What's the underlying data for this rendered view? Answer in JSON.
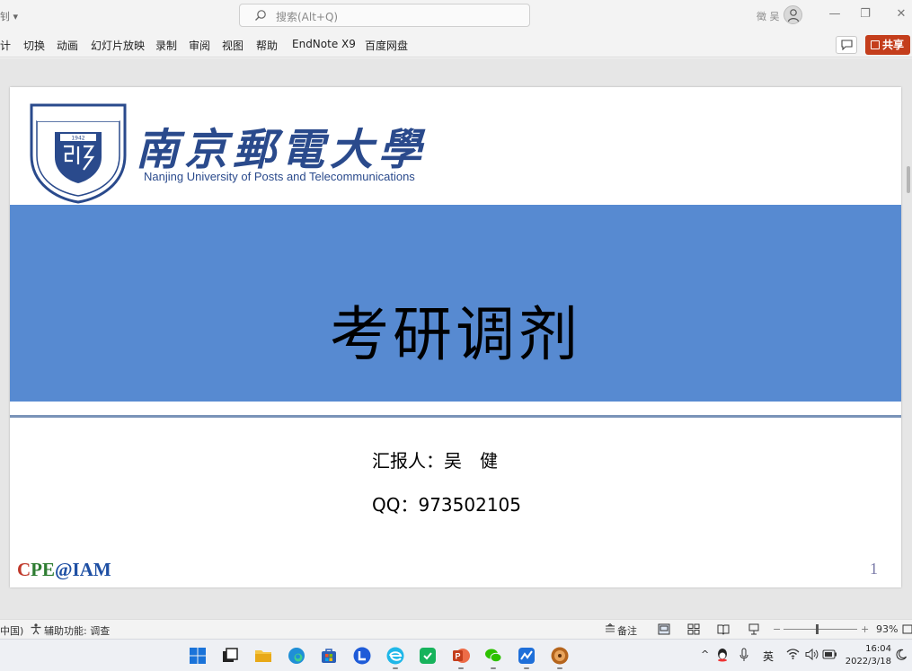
{
  "titlebar": {
    "left_fragment": "钊 ▾",
    "search_placeholder": "搜索(Alt+Q)",
    "user_name": "徵 吴",
    "minimize": "—",
    "restore": "❐",
    "close": "✕"
  },
  "ribbon": {
    "tabs": [
      "计",
      "切换",
      "动画",
      "幻灯片放映",
      "录制",
      "审阅",
      "视图",
      "帮助",
      "EndNote X9",
      "百度网盘"
    ],
    "share_label": "共享"
  },
  "slide": {
    "university_cn": "南京郵電大學",
    "university_en": "Nanjing University of Posts and Telecommunications",
    "seal_text": "1942",
    "title": "考研调剂",
    "reporter": "汇报人：吴　健",
    "qq": "QQ：973502105",
    "footer_cpe_1": "C",
    "footer_cpe_2": "PE",
    "footer_cpe_3": "@IAM",
    "page_number": "1"
  },
  "statusbar": {
    "language": "中国)",
    "accessibility": "辅助功能: 调查",
    "notes": "备注",
    "zoom_minus": "−",
    "zoom_plus": "+",
    "zoom_level": "93%"
  },
  "taskbar": {
    "ime": "英",
    "time": "16:04",
    "date": "2022/3/18"
  },
  "colors": {
    "band": "#578ad1",
    "share": "#c43e1c",
    "logo": "#2a4a8c"
  }
}
